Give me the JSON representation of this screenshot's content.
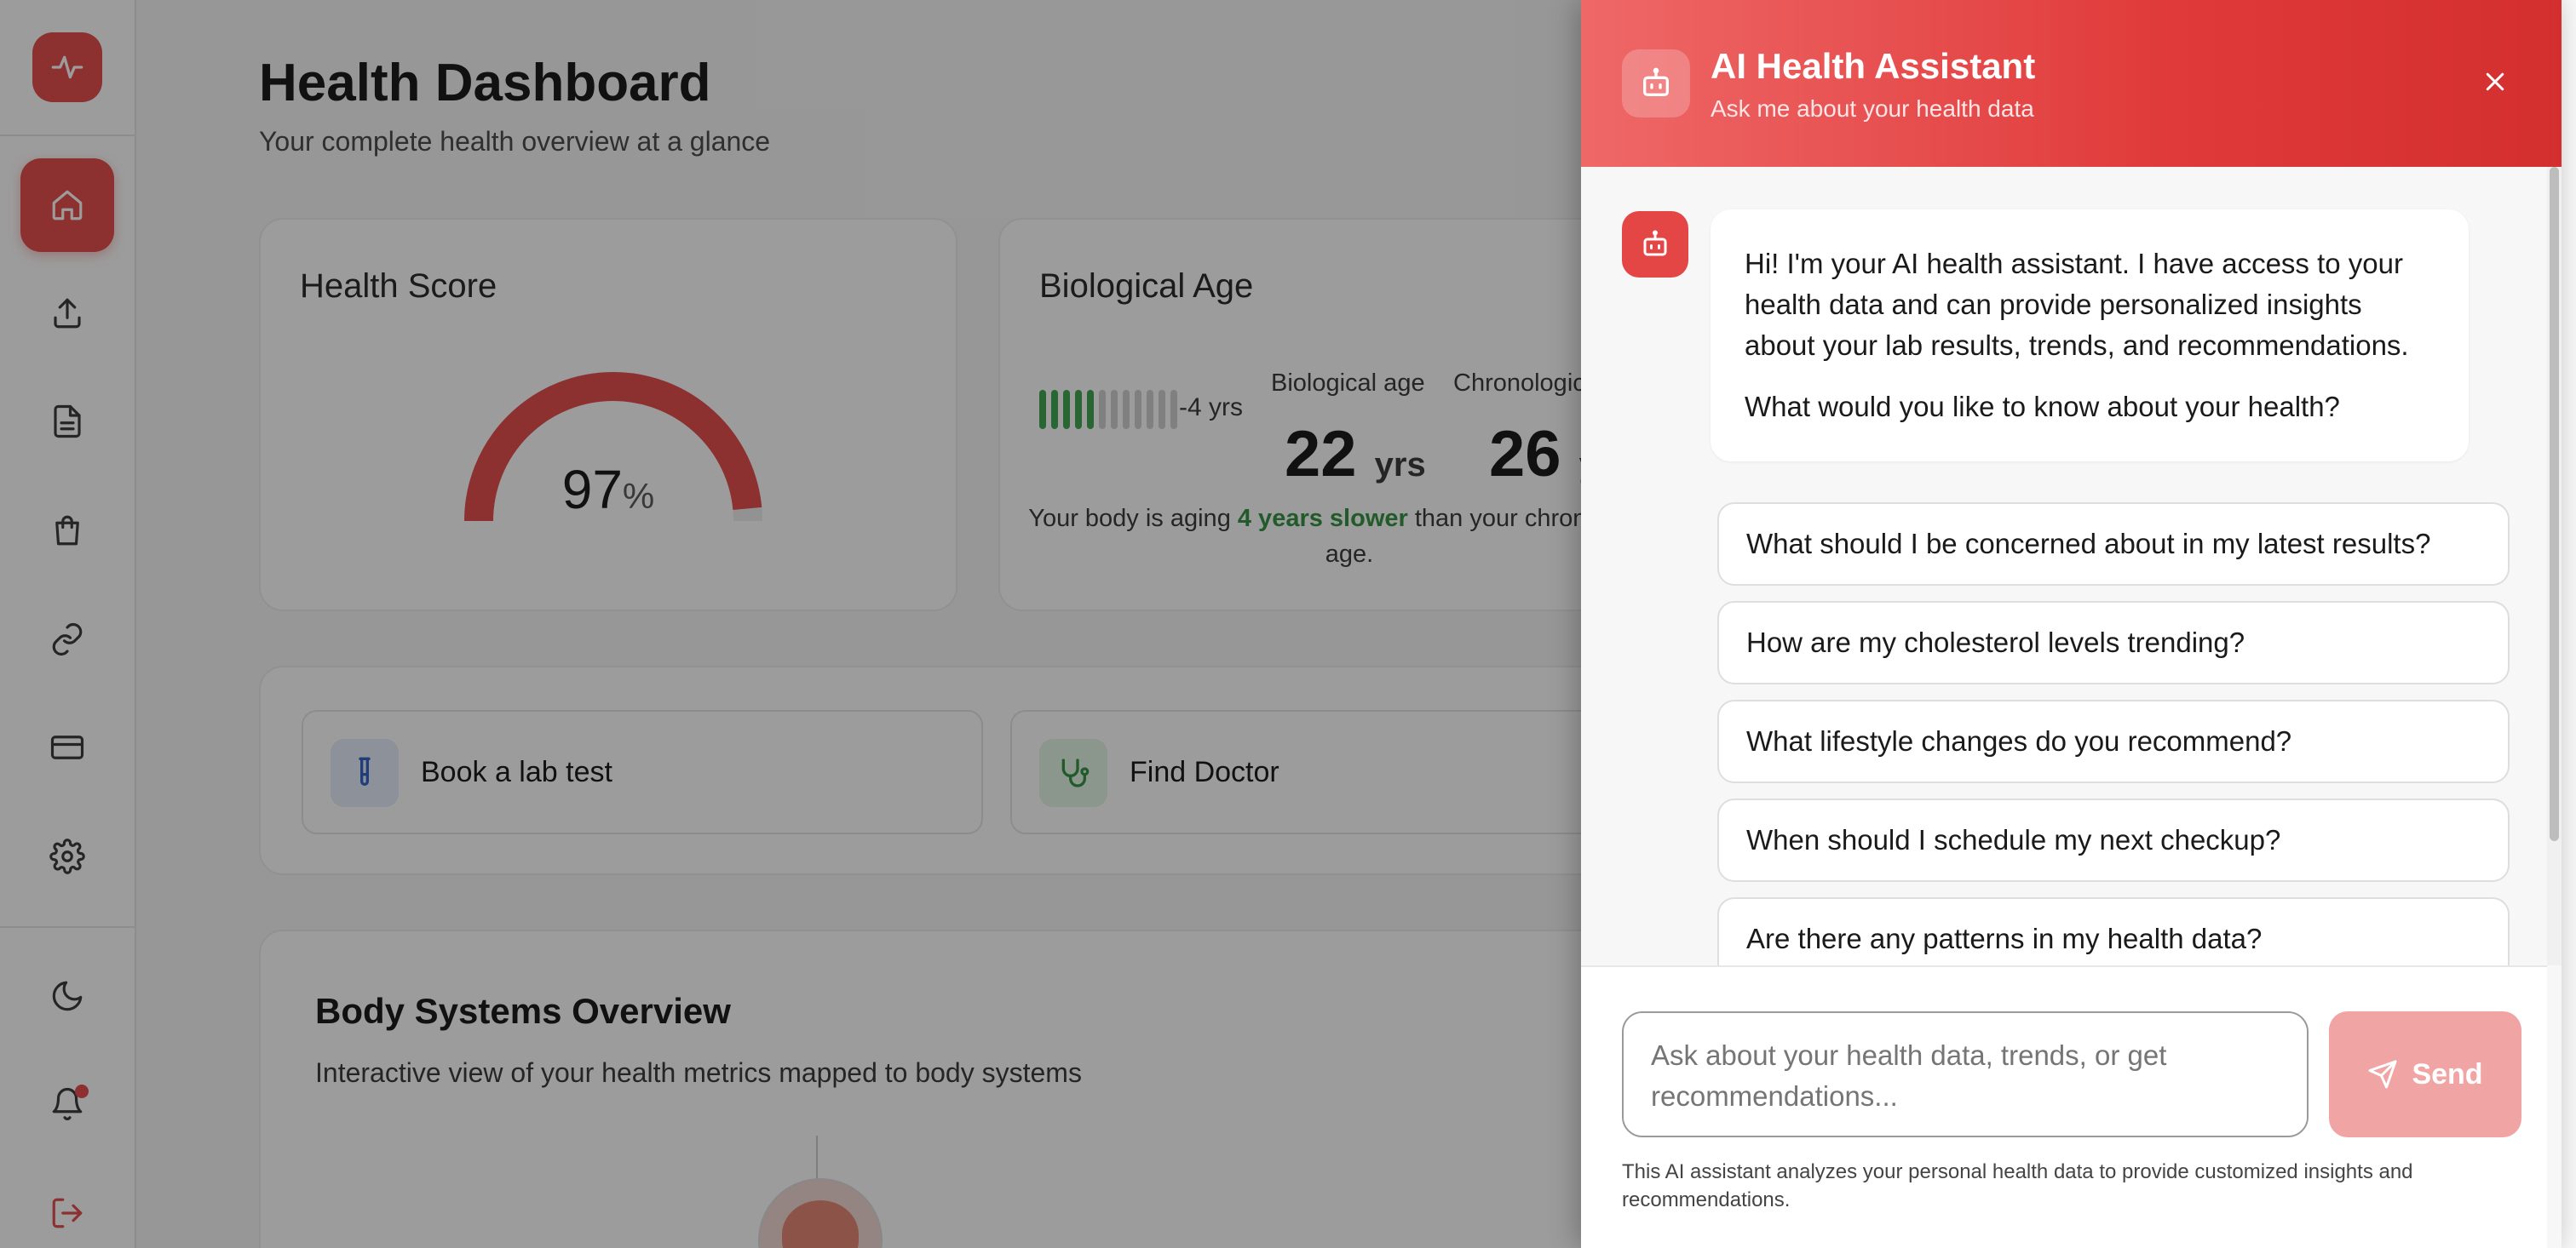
{
  "colors": {
    "brand": "#e44646",
    "success": "#2e8f3c",
    "send_disabled": "#f1a4a4"
  },
  "sidebar": {
    "logo_icon": "pulse-icon",
    "nav": [
      {
        "name": "home",
        "icon": "home-icon",
        "active": true
      },
      {
        "name": "upload",
        "icon": "upload-icon"
      },
      {
        "name": "reports",
        "icon": "document-icon"
      },
      {
        "name": "shop",
        "icon": "shopping-bag-icon"
      },
      {
        "name": "integrations",
        "icon": "link-icon"
      },
      {
        "name": "billing",
        "icon": "credit-card-icon"
      },
      {
        "name": "settings",
        "icon": "gear-icon"
      }
    ],
    "bottom": [
      {
        "name": "theme",
        "icon": "moon-icon"
      },
      {
        "name": "notifications",
        "icon": "bell-icon",
        "has_unread": true
      },
      {
        "name": "logout",
        "icon": "logout-icon"
      }
    ]
  },
  "dashboard": {
    "title": "Health Dashboard",
    "subtitle": "Your complete health overview at a glance",
    "health_score": {
      "title": "Health Score",
      "value": "97",
      "unit": "%",
      "fraction": 0.97
    },
    "biological_age": {
      "title": "Biological Age",
      "bar_filled": 5,
      "bar_total": 12,
      "delta": "-4 yrs",
      "bio_label": "Biological age",
      "bio_value": "22",
      "bio_unit": "yrs",
      "chrono_label": "Chronological age",
      "chrono_value": "26",
      "chrono_unit": "yrs",
      "summary_pre": "Your body is aging ",
      "summary_highlight": "4 years slower",
      "summary_post": " than your chronological age."
    },
    "actions": [
      {
        "label": "Book a lab test",
        "icon": "test-tube-icon"
      },
      {
        "label": "Find Doctor",
        "icon": "stethoscope-icon"
      }
    ],
    "body_systems": {
      "title": "Body Systems Overview",
      "subtitle": "Interactive view of your health metrics mapped to body systems"
    }
  },
  "assistant": {
    "title": "AI Health Assistant",
    "subtitle": "Ask me about your health data",
    "greeting_1": "Hi! I'm your AI health assistant. I have access to your health data and can provide personalized insights about your lab results, trends, and recommendations.",
    "greeting_2": "What would you like to know about your health?",
    "suggestions": [
      "What should I be concerned about in my latest results?",
      "How are my cholesterol levels trending?",
      "What lifestyle changes do you recommend?",
      "When should I schedule my next checkup?",
      "Are there any patterns in my health data?"
    ],
    "input_placeholder": "Ask about your health data, trends, or get recommendations...",
    "send_label": "Send",
    "disclaimer": "This AI assistant analyzes your personal health data to provide customized insights and recommendations."
  }
}
